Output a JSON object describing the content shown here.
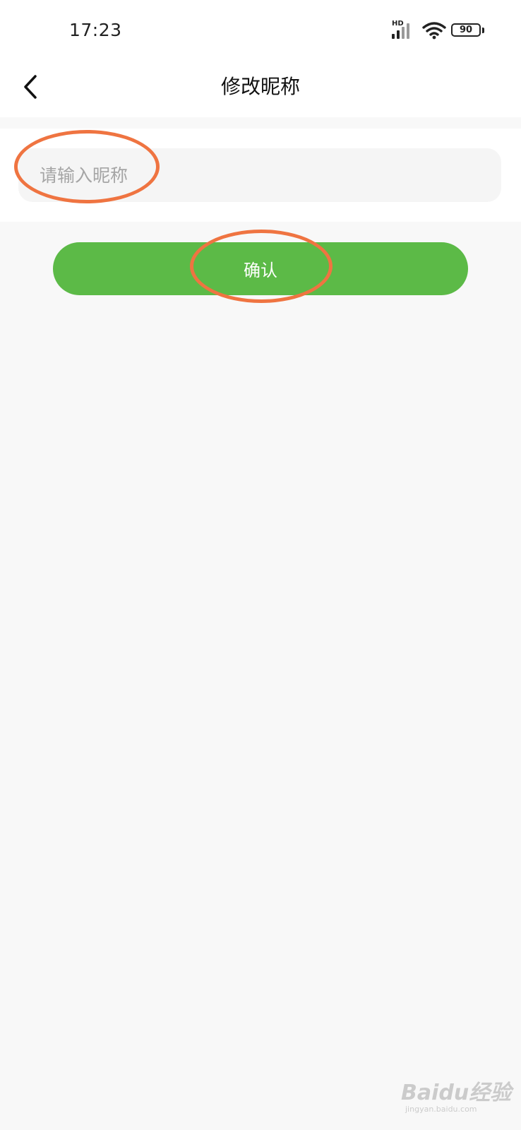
{
  "status_bar": {
    "time": "17:23",
    "network_label": "HD",
    "battery_level": "90",
    "icons": [
      "signal-icon",
      "wifi-icon",
      "battery-icon"
    ]
  },
  "nav": {
    "title": "修改昵称",
    "back_icon": "chevron-left-icon"
  },
  "form": {
    "nickname_value": "",
    "nickname_placeholder": "请输入昵称",
    "confirm_label": "确认"
  },
  "colors": {
    "accent": "#5cba47",
    "annotation": "#ef7441",
    "background": "#f8f8f8"
  },
  "watermark": {
    "brand": "Baidu经验",
    "url": "jingyan.baidu.com"
  }
}
